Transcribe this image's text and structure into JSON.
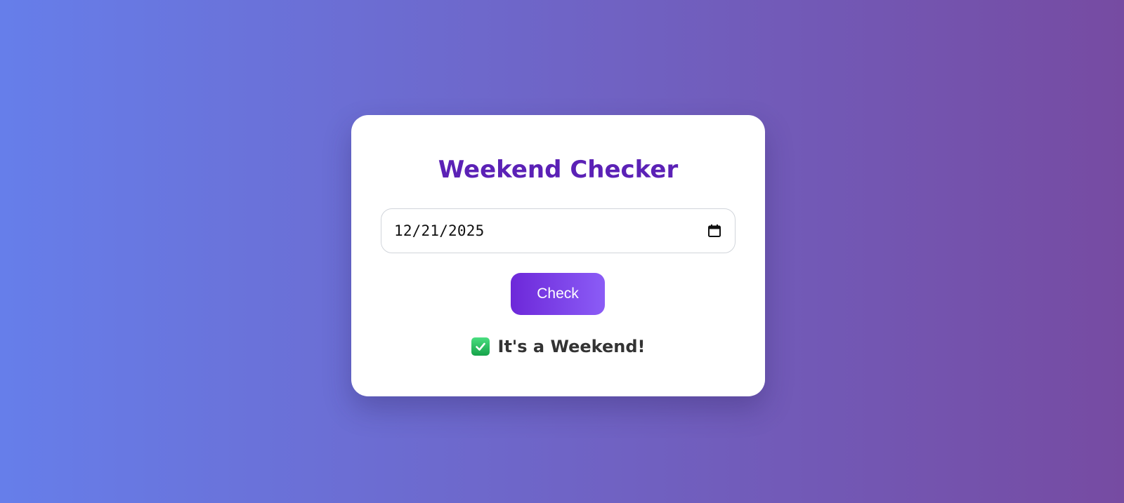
{
  "app": {
    "title": "Weekend Checker"
  },
  "date_input": {
    "value": "12/21/2025",
    "icon": "calendar-icon"
  },
  "check_button": {
    "label": "Check"
  },
  "result": {
    "icon": "check-mark-emoji-icon",
    "text": "It's a Weekend!"
  },
  "colors": {
    "background_start": "#667eea",
    "background_end": "#764ba2",
    "title": "#5b21b6",
    "button_start": "#6d28d9",
    "button_end": "#8b5cf6",
    "result_text": "#333333"
  }
}
